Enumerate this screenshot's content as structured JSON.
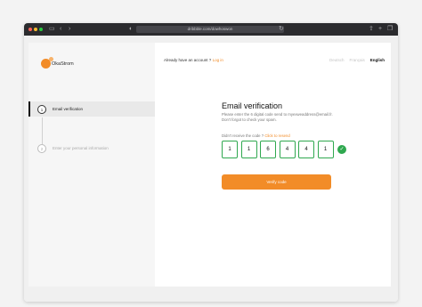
{
  "browser": {
    "url": "dribbble.com/dowhoswon",
    "traffic_lights": [
      "#ff5f57",
      "#febc2e",
      "#28c840"
    ]
  },
  "brand": {
    "name": "OkaStrom",
    "accent": "#f28c28"
  },
  "steps": [
    {
      "number": "1",
      "label": "Email verification",
      "active": true
    },
    {
      "number": "2",
      "label": "Enter your personal information",
      "active": false
    }
  ],
  "header": {
    "account_text": "Already have an account ?",
    "login_link": "Log in",
    "languages": [
      "Deutsch",
      "Français",
      "English"
    ],
    "active_language": "English"
  },
  "verification": {
    "title": "Email verification",
    "subtitle_line1": "Please enter the 6 digital code send to myexweaddress@email.fr.",
    "subtitle_line2": "Don't forgot to check your spam.",
    "resend_text": "Didn't receive the code ?",
    "resend_link": "Click to resend",
    "code_digits": [
      "1",
      "1",
      "6",
      "4",
      "4",
      "1"
    ],
    "verify_button": "Verify code"
  }
}
